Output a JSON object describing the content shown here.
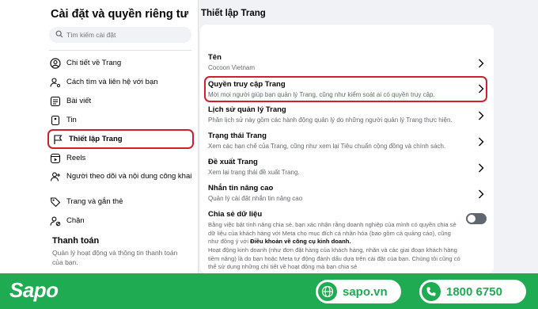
{
  "sidebar": {
    "title": "Cài đặt và quyền riêng tư",
    "search_placeholder": "Tìm kiếm cài đặt",
    "items": [
      {
        "label": "Chi tiết về Trang",
        "icon": "user-circle-icon"
      },
      {
        "label": "Cách tìm và liên hệ với bạn",
        "icon": "user-gear-icon"
      },
      {
        "label": "Bài viết",
        "icon": "posts-icon"
      },
      {
        "label": "Tin",
        "icon": "stories-icon"
      },
      {
        "label": "Thiết lập Trang",
        "icon": "flag-icon",
        "active": true
      },
      {
        "label": "Reels",
        "icon": "reels-icon"
      },
      {
        "label": "Người theo dõi và nội dung công khai",
        "icon": "followers-icon"
      },
      {
        "label": "Trang và gắn thẻ",
        "icon": "tag-icon"
      },
      {
        "label": "Chặn",
        "icon": "block-user-icon"
      }
    ],
    "payments": {
      "title": "Thanh toán",
      "desc": "Quản lý hoạt động và thông tin thanh toán của bạn."
    }
  },
  "main": {
    "title": "Thiết lập Trang",
    "rows": [
      {
        "title": "Tên",
        "desc": "Cocoon Vietnam"
      },
      {
        "title": "Quyền truy cập Trang",
        "desc": "Mời mọi người giúp bạn quản lý Trang, cũng như kiểm soát ai có quyền truy cập.",
        "highlighted": true
      },
      {
        "title": "Lịch sử quản lý Trang",
        "desc": "Phân lịch sử này gồm các hành động quản lý do những người quản lý Trang thực hiện."
      },
      {
        "title": "Trạng thái Trang",
        "desc": "Xem các hạn chế của Trang, cũng như xem lại Tiêu chuẩn cộng đồng và chính sách."
      },
      {
        "title": "Đề xuất Trang",
        "desc": "Xem lại trạng thái đề xuất Trang."
      },
      {
        "title": "Nhắn tin nâng cao",
        "desc": "Quản lý cài đặt nhắn tin nâng cao"
      }
    ],
    "data_sharing": {
      "title": "Chia sẻ dữ liệu",
      "para1_a": "Bằng việc bật tính năng chia sẻ, bạn xác nhận rằng doanh nghiệp của mình có quyền chia sẻ dữ liệu của khách hàng với Meta cho mục đích cá nhân hóa (bao gồm cả quảng cáo), cũng như đồng ý với ",
      "para1_bold": "Điều khoản về công cụ kinh doanh.",
      "para2": "Hoạt động kinh doanh (như đơn đặt hàng của khách hàng, nhãn và các giai đoạn khách hàng tiềm năng) là do bạn hoặc Meta tự động đánh dấu dựa trên cài đặt của bạn. Chúng tôi cũng có thể sử dụng những chi tiết về hoạt động mà bạn chia sẻ",
      "toggle_on": false
    }
  },
  "footer": {
    "logo": "Sapo",
    "website": "sapo.vn",
    "phone": "1800 6750",
    "brand_color": "#1fab52"
  },
  "colors": {
    "highlight": "#d0202e",
    "muted_text": "#65676b"
  }
}
